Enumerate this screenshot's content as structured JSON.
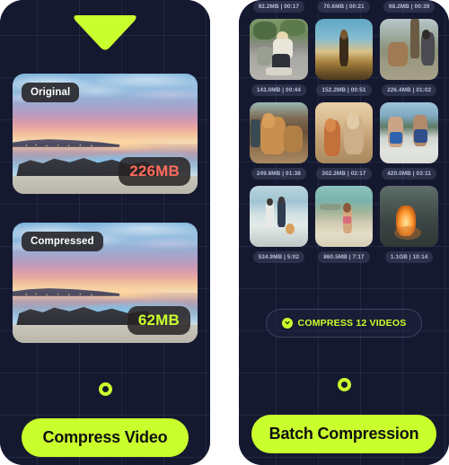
{
  "app": {
    "accent_green": "#CAFF2E",
    "accent_red": "#FF6A5A",
    "background": "#151930"
  },
  "left_panel": {
    "name": "single-video-compression-screen",
    "arrow_icon": "triangle-down-icon",
    "original_card": {
      "label": "Original",
      "size": "226MB"
    },
    "compressed_card": {
      "label": "Compressed",
      "size": "62MB"
    },
    "home_indicator_icon": "ring-icon",
    "cta_label": "Compress Video"
  },
  "right_panel": {
    "name": "batch-compression-screen",
    "videos": [
      {
        "meta": "92.2MB | 00:17",
        "thumb": "thumb-partial-1"
      },
      {
        "meta": "70.6MB | 00:21",
        "thumb": "thumb-partial-2"
      },
      {
        "meta": "98.2MB | 00:39",
        "thumb": "thumb-partial-3"
      },
      {
        "meta": "143.0MB | 00:44",
        "thumb": "thumb-woman-skateboard"
      },
      {
        "meta": "152.2MB | 00:51",
        "thumb": "thumb-woman-sunset-field"
      },
      {
        "meta": "226.4MB | 01:02",
        "thumb": "thumb-person-with-deer"
      },
      {
        "meta": "249.8MB | 01:38",
        "thumb": "thumb-cat-indoors"
      },
      {
        "meta": "302.2MB | 02:17",
        "thumb": "thumb-two-dogs-running"
      },
      {
        "meta": "420.0MB | 03:11",
        "thumb": "thumb-beach-volleyball"
      },
      {
        "meta": "534.9MB | 5:02",
        "thumb": "thumb-couple-beach-walk"
      },
      {
        "meta": "860.5MB | 7:17",
        "thumb": "thumb-girl-running-beach"
      },
      {
        "meta": "1.1GB | 10:14",
        "thumb": "thumb-bonfire-beach"
      }
    ],
    "compress_all": {
      "icon": "compress-circle-icon",
      "label": "COMPRESS 12 VIDEOS"
    },
    "home_indicator_icon": "ring-icon",
    "cta_label": "Batch Compression"
  }
}
